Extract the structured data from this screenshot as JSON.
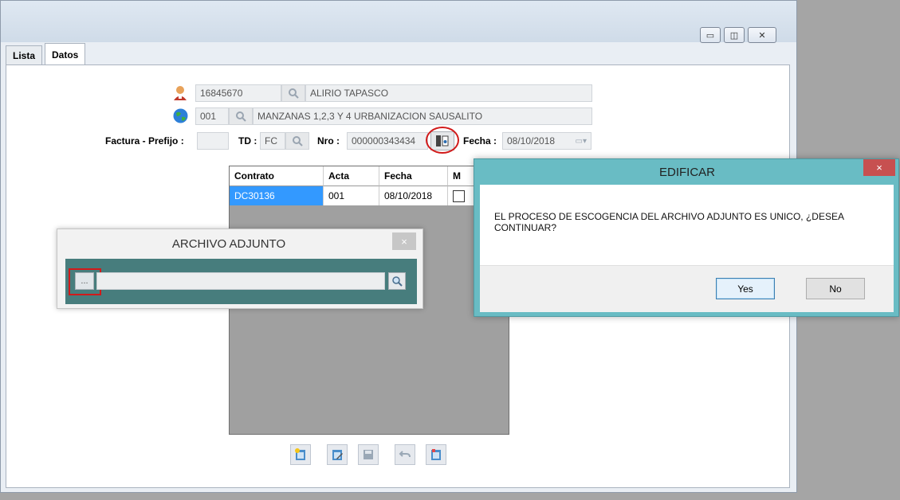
{
  "tabs": [
    {
      "label": "Lista"
    },
    {
      "label": "Datos"
    }
  ],
  "form": {
    "client_code": "16845670",
    "client_name": "ALIRIO TAPASCO",
    "zone_code": "001",
    "zone_name": "MANZANAS 1,2,3 Y 4  URBANIZACION SAUSALITO",
    "factura_label": "Factura - Prefijo :",
    "factura_value": "",
    "td_label": "TD :",
    "td_value": "FC",
    "nro_label": "Nro :",
    "nro_value": "000000343434",
    "fecha_label": "Fecha :",
    "fecha_value": "08/10/2018"
  },
  "grid": {
    "columns": [
      "Contrato",
      "Acta",
      "Fecha",
      "M"
    ],
    "rows": [
      {
        "contrato": "DC30136",
        "acta": "001",
        "fecha": "08/10/2018",
        "m": false
      }
    ]
  },
  "archivo_dialog": {
    "title": "ARCHIVO ADJUNTO",
    "close": "×",
    "browse_label": "...",
    "path_value": ""
  },
  "edificar_dialog": {
    "title": "EDIFICAR",
    "close": "×",
    "message": "EL PROCESO DE ESCOGENCIA DEL ARCHIVO ADJUNTO ES UNICO, ¿DESEA CONTINUAR?",
    "yes_label": "Yes",
    "no_label": "No"
  },
  "colors": {
    "accent_teal": "#477d7d",
    "dialog_frame": "#69bcc4",
    "selection_blue": "#3399ff",
    "highlight_red": "#d11a1a"
  }
}
